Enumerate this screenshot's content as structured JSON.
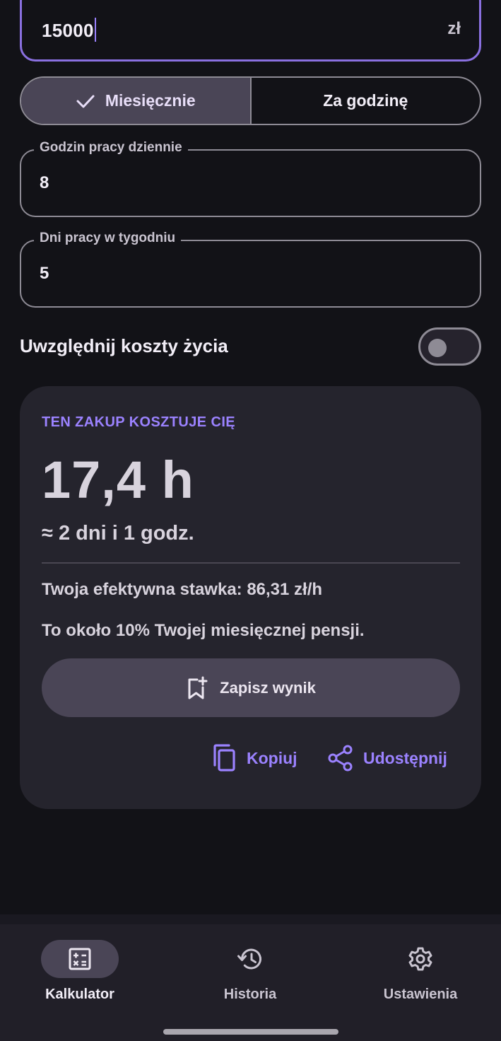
{
  "salary": {
    "value": "15000",
    "suffix": "zł"
  },
  "period_toggle": {
    "options": [
      {
        "label": "Miesięcznie",
        "selected": true
      },
      {
        "label": "Za godzinę",
        "selected": false
      }
    ]
  },
  "hours_field": {
    "label": "Godzin pracy dziennie",
    "value": "8"
  },
  "days_field": {
    "label": "Dni pracy w tygodniu",
    "value": "5"
  },
  "cost_of_living": {
    "label": "Uwzględnij koszty życia",
    "enabled": false
  },
  "result": {
    "eyebrow": "TEN ZAKUP KOSZTUJE CIĘ",
    "hours": "17,4 h",
    "approx": "≈ 2 dni i 1 godz.",
    "rate": "Twoja efektywna stawka: 86,31 zł/h",
    "share": "To około 10% Twojej miesięcznej pensji.",
    "save_label": "Zapisz wynik",
    "copy_label": "Kopiuj",
    "share_label": "Udostępnij"
  },
  "bottom_nav": {
    "items": [
      {
        "label": "Kalkulator",
        "icon": "calculator-icon",
        "active": true
      },
      {
        "label": "Historia",
        "icon": "history-icon",
        "active": false
      },
      {
        "label": "Ustawienia",
        "icon": "gear-icon",
        "active": false
      }
    ]
  },
  "colors": {
    "background": "#121217",
    "accent": "#9b82ff",
    "card": "#25242d",
    "selected": "#4a4556"
  }
}
